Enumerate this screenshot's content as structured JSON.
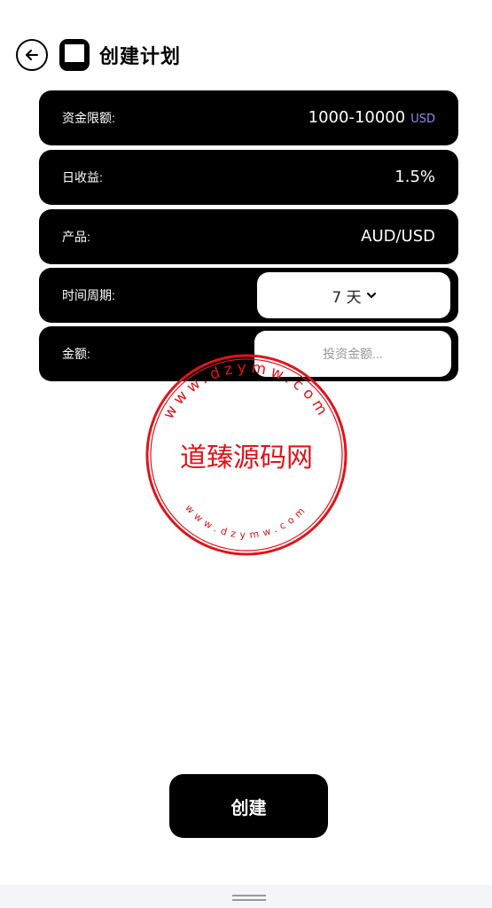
{
  "header": {
    "title": "创建计划"
  },
  "form": {
    "fund_limit": {
      "label": "资金限额:",
      "value": "1000-10000",
      "unit": "USD"
    },
    "daily_return": {
      "label": "日收益:",
      "value": "1.5%"
    },
    "product": {
      "label": "产品:",
      "value": "AUD/USD"
    },
    "period": {
      "label": "时间周期:",
      "selected": "7 天"
    },
    "amount": {
      "label": "金额:",
      "placeholder": "投资金额..."
    }
  },
  "watermark": {
    "center_text": "道臻源码网",
    "ring_text": "www.dzymw.com"
  },
  "actions": {
    "create_label": "创建"
  },
  "colors": {
    "row_bg": "#000000",
    "unit_accent": "#8f8ae8",
    "stamp_red": "#e0141b",
    "bottom_bar": "#f4f5f7"
  }
}
